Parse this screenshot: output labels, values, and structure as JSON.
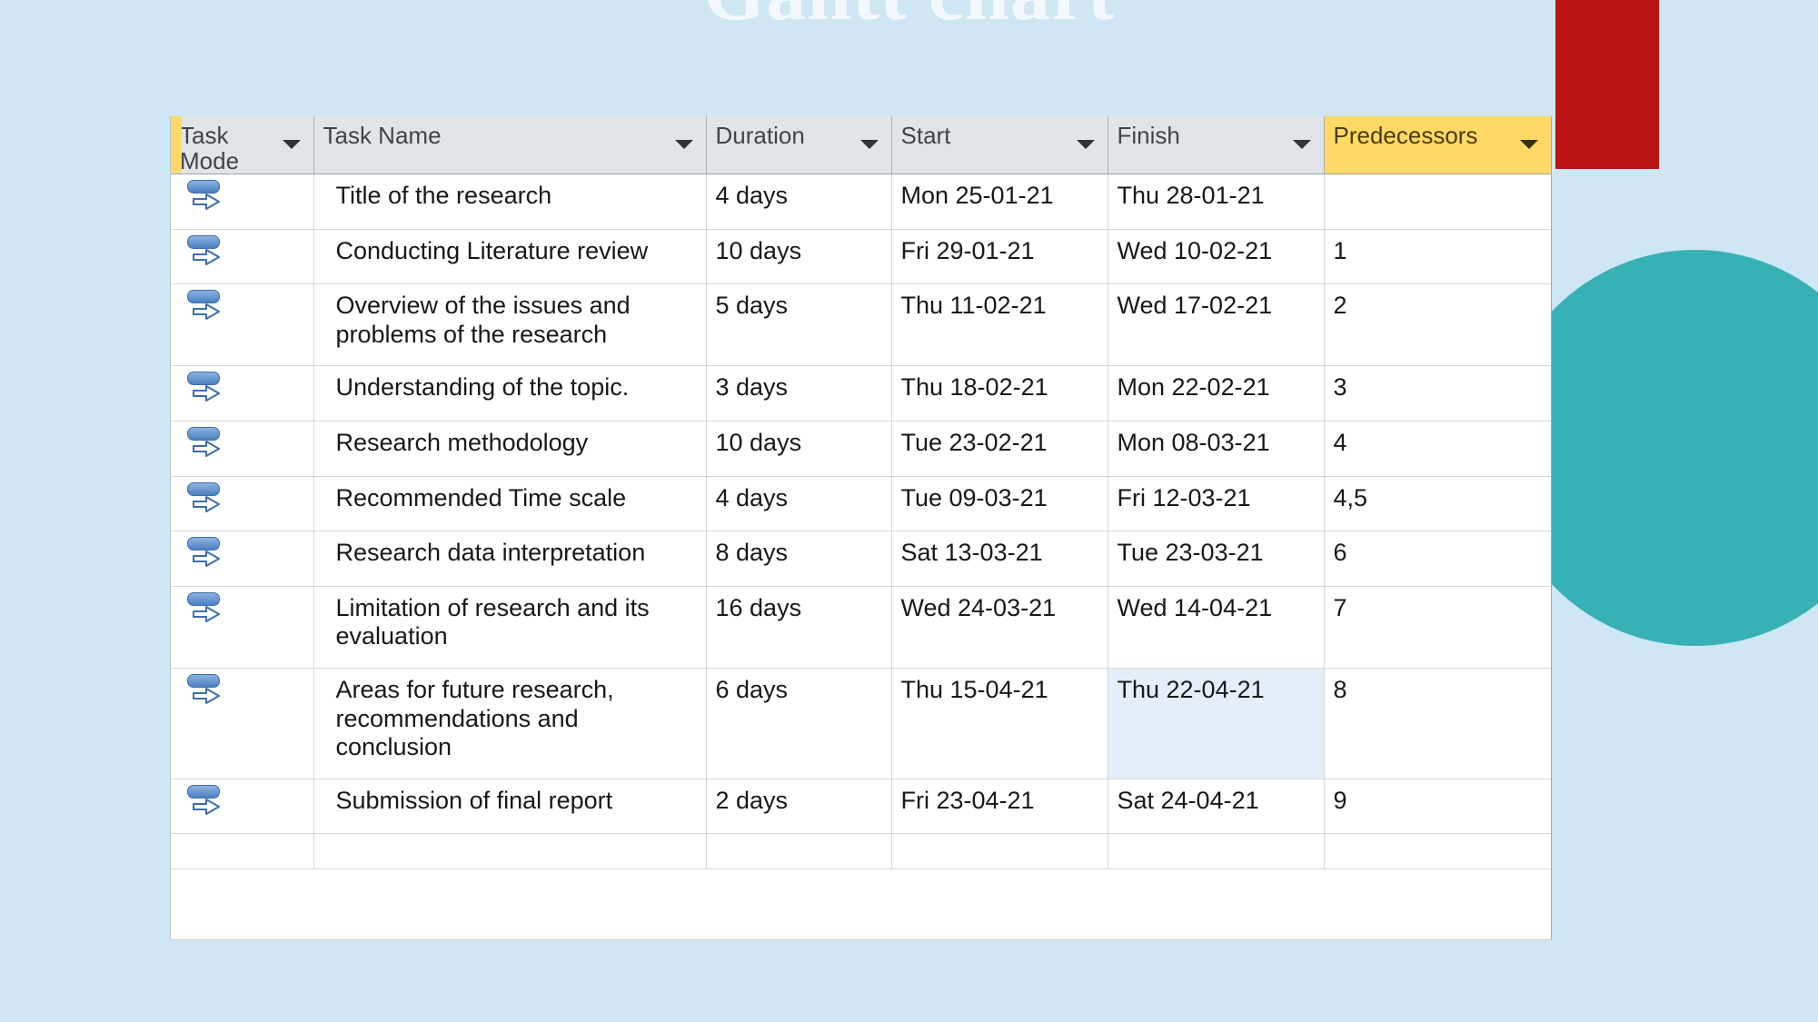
{
  "slide": {
    "title": "Gantt chart",
    "background_color": "#cfe7f5",
    "decorations": {
      "red_rect_color": "#b91411",
      "teal_circle_color": "#38b1b6"
    }
  },
  "table": {
    "columns": [
      {
        "key": "task_mode",
        "label": "Task Mode",
        "has_sort_arrow": true,
        "header_bg": "#e2e5e8"
      },
      {
        "key": "task_name",
        "label": "Task Name",
        "has_sort_arrow": true,
        "header_bg": "#e2e5e8"
      },
      {
        "key": "duration",
        "label": "Duration",
        "has_sort_arrow": true,
        "header_bg": "#e2e5e8"
      },
      {
        "key": "start",
        "label": "Start",
        "has_sort_arrow": true,
        "header_bg": "#e2e5e8"
      },
      {
        "key": "finish",
        "label": "Finish",
        "has_sort_arrow": true,
        "header_bg": "#e2e5e8"
      },
      {
        "key": "predecessors",
        "label": "Predecessors",
        "has_sort_arrow": true,
        "header_bg": "#ffd966"
      }
    ],
    "selected_cell": {
      "row": 9,
      "column": "finish"
    },
    "rows": [
      {
        "mode_icon": "auto-schedule-icon",
        "task_name": "Title of the research",
        "duration": "4 days",
        "start": "Mon 25-01-21",
        "finish": "Thu 28-01-21",
        "predecessors": ""
      },
      {
        "mode_icon": "auto-schedule-icon",
        "task_name": "Conducting Literature review",
        "duration": "10 days",
        "start": "Fri 29-01-21",
        "finish": "Wed 10-02-21",
        "predecessors": "1"
      },
      {
        "mode_icon": "auto-schedule-icon",
        "task_name": "Overview of the issues and problems of the research",
        "duration": "5 days",
        "start": "Thu 11-02-21",
        "finish": "Wed 17-02-21",
        "predecessors": "2"
      },
      {
        "mode_icon": "auto-schedule-icon",
        "task_name": "Understanding of the topic.",
        "duration": "3 days",
        "start": "Thu 18-02-21",
        "finish": "Mon 22-02-21",
        "predecessors": "3"
      },
      {
        "mode_icon": "auto-schedule-icon",
        "task_name": "Research methodology",
        "duration": "10 days",
        "start": "Tue 23-02-21",
        "finish": "Mon 08-03-21",
        "predecessors": "4"
      },
      {
        "mode_icon": "auto-schedule-icon",
        "task_name": "Recommended Time scale",
        "duration": "4 days",
        "start": "Tue 09-03-21",
        "finish": "Fri 12-03-21",
        "predecessors": "4,5"
      },
      {
        "mode_icon": "auto-schedule-icon",
        "task_name": "Research data interpretation",
        "duration": "8 days",
        "start": "Sat 13-03-21",
        "finish": "Tue 23-03-21",
        "predecessors": "6"
      },
      {
        "mode_icon": "auto-schedule-icon",
        "task_name": "Limitation of research and its evaluation",
        "duration": "16 days",
        "start": "Wed 24-03-21",
        "finish": "Wed 14-04-21",
        "predecessors": "7"
      },
      {
        "mode_icon": "auto-schedule-icon",
        "task_name": "Areas for future research, recommendations and conclusion",
        "duration": "6 days",
        "start": "Thu 15-04-21",
        "finish": "Thu 22-04-21",
        "predecessors": "8"
      },
      {
        "mode_icon": "auto-schedule-icon",
        "task_name": "Submission of final report",
        "duration": "2 days",
        "start": "Fri 23-04-21",
        "finish": "Sat 24-04-21",
        "predecessors": "9"
      }
    ]
  }
}
